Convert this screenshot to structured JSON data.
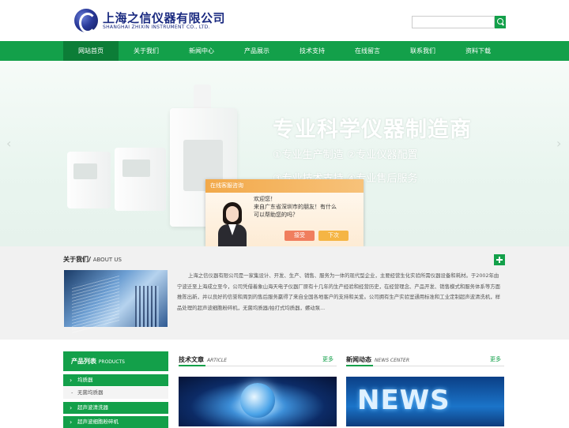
{
  "header": {
    "logo_cn": "上海之信仪器有限公司",
    "logo_en": "SHANGHAI ZHIXIN INSTRUMENT CO., LTD.",
    "search_placeholder": ""
  },
  "nav": {
    "items": [
      {
        "label": "网站首页",
        "active": true
      },
      {
        "label": "关于我们"
      },
      {
        "label": "新闻中心"
      },
      {
        "label": "产品展示"
      },
      {
        "label": "技术支持"
      },
      {
        "label": "在线留言"
      },
      {
        "label": "联系我们"
      },
      {
        "label": "资料下载"
      }
    ]
  },
  "banner": {
    "title": "专业科学仪器制造商",
    "line1": "①专业生产制造  ②专业仪器配置",
    "line2": "③专业技术支持  ④专业售后服务"
  },
  "chat": {
    "header": "在线客服咨询",
    "greeting": "欢迎您！",
    "line1": "来自广东省深圳市的朋友！有什么",
    "line2": "可以帮助您的吗？",
    "accept": "接受",
    "later": "下次"
  },
  "about": {
    "title": "关于我们/",
    "title_en": "ABOUT US",
    "text": "上海之信仪器有限公司是一家集设计、开发、生产、销售、服务为一体的现代型企业，主要经营生化实验所需仪器设备和耗材。于2002年由宁波迁至上海成立至今，公司凭借着象山海天电子仪器厂原有十几年的生产经验和经营历史，在经营理念、产品开发、销售模式和服务体系等方面推陈出新，并以良好的信誉和周到的售后服务赢得了来自全国各地客户的支持和关爱。公司拥有生产实验室通用标准和工业定制超声波清洗机，样品处理的超声波细胞粉碎机，无菌均质器/拍打式均质器，螺动泵..."
  },
  "product_list": {
    "title": "产品列表",
    "title_en": "PRODUCTS",
    "items": [
      {
        "label": "均质器",
        "type": "cat"
      },
      {
        "label": "无菌均质器",
        "type": "sub"
      },
      {
        "label": "超声波清洗器",
        "type": "cat"
      },
      {
        "label": "超声波细胞粉碎机",
        "type": "cat"
      }
    ]
  },
  "articles": {
    "title": "技术文章",
    "title_en": "ARTICLE",
    "more": "更多"
  },
  "news": {
    "title": "新闻动态",
    "title_en": "NEWS CENTER",
    "more": "更多",
    "image_word": "NEWS"
  },
  "colors": {
    "accent": "#13a04a",
    "nav_active": "#0c7d37",
    "chat_header": "#f2a94a"
  }
}
